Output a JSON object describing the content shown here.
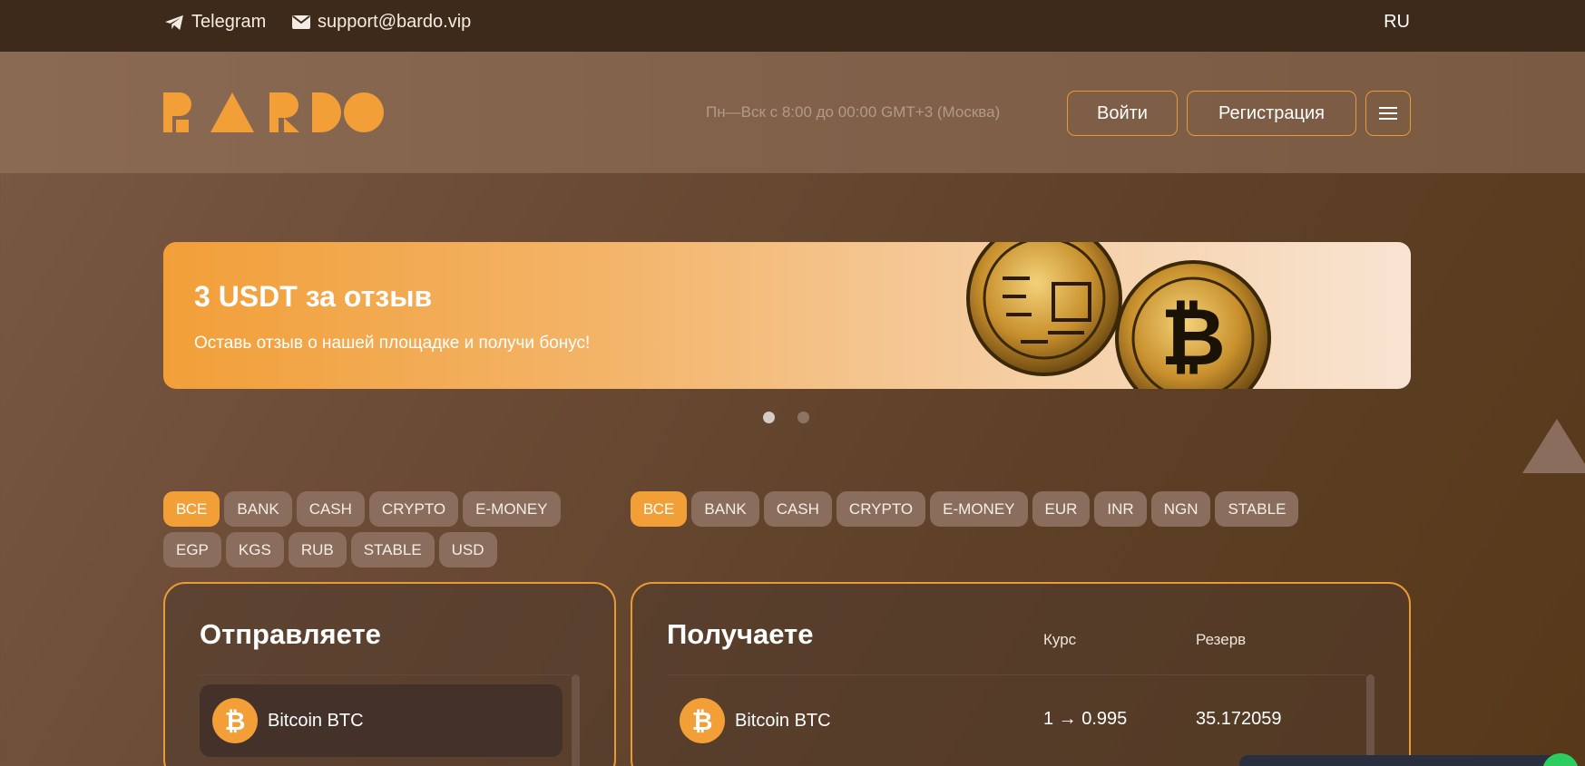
{
  "topbar": {
    "telegram": "Telegram",
    "email": "support@bardo.vip",
    "lang": "RU"
  },
  "header": {
    "brand": "BARDO",
    "hours": "Пн—Вск с 8:00 до 00:00 GMT+3 (Москва)",
    "login": "Войти",
    "register": "Регистрация"
  },
  "banner": {
    "title": "3 USDT за отзыв",
    "subtitle": "Оставь отзыв о нашей площадке и получи бонус!"
  },
  "filters_send": [
    "ВСЕ",
    "BANK",
    "CASH",
    "CRYPTO",
    "E-MONEY",
    "EGP",
    "KGS",
    "RUB",
    "STABLE",
    "USD"
  ],
  "filters_receive": [
    "ВСЕ",
    "BANK",
    "CASH",
    "CRYPTO",
    "E-MONEY",
    "EUR",
    "INR",
    "NGN",
    "STABLE"
  ],
  "send": {
    "title": "Отправляете",
    "items": [
      {
        "name": "Bitcoin BTC"
      }
    ]
  },
  "receive": {
    "title": "Получаете",
    "col_rate": "Курс",
    "col_reserve": "Резерв",
    "items": [
      {
        "name": "Bitcoin BTC",
        "rate": "1 → 0.995",
        "reserve": "35.172059"
      }
    ]
  },
  "colors": {
    "accent": "#f29f38",
    "topbar": "#3e2a1a",
    "chip": "#8a6d5c"
  }
}
